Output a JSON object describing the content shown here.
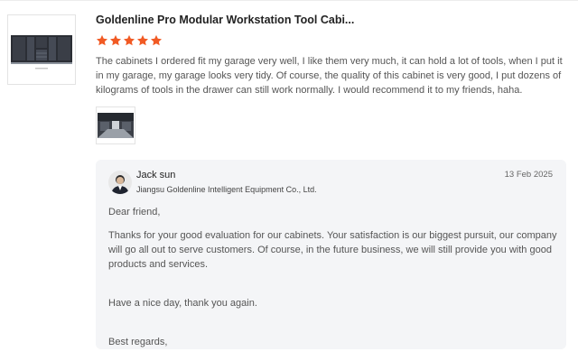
{
  "product": {
    "title": "Goldenline Pro Modular Workstation Tool Cabi...",
    "thumbnail_icon": "tool-cabinet-image",
    "rating": 5,
    "star_color": "#f15a24"
  },
  "review": {
    "text": "The cabinets I ordered fit my garage very well, I like them very much, it can hold a lot of tools, when I put it in my garage, my garage looks very tidy. Of course, the quality of this cabinet is very good, I put dozens of kilograms of tools in the drawer can still work normally. I would recommend it to my friends, haha.",
    "photo_icon": "garage-photo"
  },
  "reply": {
    "name": "Jack sun",
    "company": "Jiangsu Goldenline Intelligent Equipment Co., Ltd.",
    "date": "13 Feb 2025",
    "greeting": "Dear friend,",
    "paragraph": "Thanks for your good evaluation for our cabinets. Your satisfaction is our biggest pursuit, our company will go all out to serve customers. Of course, in the future business, we will still provide you with good products and services.",
    "closing": "Have a nice day, thank you again.",
    "signoff": "Best regards,",
    "background": "#f4f5f7"
  }
}
